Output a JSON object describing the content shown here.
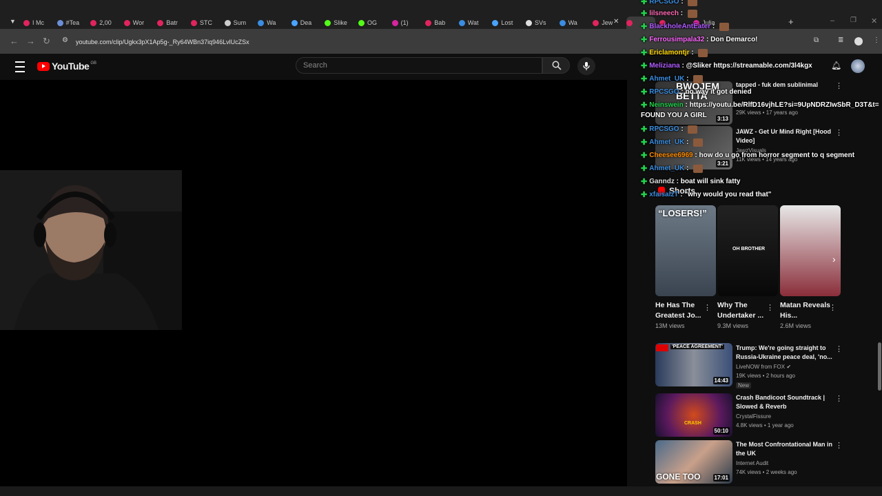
{
  "browser": {
    "tabs": [
      {
        "label": "I Mc",
        "color": "#e0245e"
      },
      {
        "label": "#Tea",
        "color": "#6b8fd6"
      },
      {
        "label": "2,00",
        "color": "#e0245e"
      },
      {
        "label": "Wor",
        "color": "#e0245e"
      },
      {
        "label": "Batr",
        "color": "#e0245e"
      },
      {
        "label": "STC",
        "color": "#e0245e"
      },
      {
        "label": "Sum",
        "color": "#cccccc"
      },
      {
        "label": "Wa",
        "color": "#3a8de0"
      },
      {
        "label": "Dea",
        "color": "#4aa3ff"
      },
      {
        "label": "Slike",
        "color": "#53fc18"
      },
      {
        "label": "OG",
        "color": "#53fc18"
      },
      {
        "label": "(1)",
        "color": "#d6249f"
      },
      {
        "label": "Bab",
        "color": "#e0245e"
      },
      {
        "label": "Wat",
        "color": "#3a8de0"
      },
      {
        "label": "Lost",
        "color": "#4aa3ff"
      },
      {
        "label": "SVs",
        "color": "#dddddd"
      },
      {
        "label": "Wa",
        "color": "#3a8de0"
      },
      {
        "label": "Jew",
        "color": "#e0245e"
      },
      {
        "label": "",
        "color": "#e0245e"
      },
      {
        "label": "",
        "color": "#e0245e"
      },
      {
        "label": "Julia",
        "color": "#d6249f"
      }
    ],
    "url": "youtube.com/clip/Ugkx3pX1Ap5g-_Ry64WBn37iq946LvlUcZSx"
  },
  "youtube": {
    "logo": "YouTube",
    "region": "GB",
    "search_placeholder": "Search"
  },
  "shorts": {
    "label": "Shorts",
    "items": [
      {
        "thumb_text": "“LOSERS!”",
        "title": "He Has The Greatest Jo...",
        "views": "13M views"
      },
      {
        "thumb_text": "OH BROTHER",
        "title": "Why The Undertaker ...",
        "views": "9.3M views"
      },
      {
        "thumb_text": "",
        "title": "Matan Reveals His...",
        "views": "2.6M views"
      }
    ]
  },
  "recommendations": {
    "top": [
      {
        "title": "tapped - fuk dem sublinimal",
        "meta": "29K views • 17 years ago",
        "duration": "3:13"
      },
      {
        "title": "JAWZ - Get Ur Mind Right [Hood Video]",
        "channel": "JawzVisuals",
        "meta": "11K views • 14 years ago",
        "duration": "3:21"
      }
    ],
    "list": [
      {
        "title": "Trump: We're going straight to Russia-Ukraine peace deal, 'no...",
        "channel": "LiveNOW from FOX",
        "meta": "19K views • 2 hours ago",
        "badge": "New",
        "duration": "14:43",
        "thumb_text": "'PEACE AGREEMENT'"
      },
      {
        "title": "Crash Bandicoot Soundtrack | Slowed & Reverb",
        "channel": "CrystalFissure",
        "meta": "4.8K views • 1 year ago",
        "duration": "50:10",
        "thumb_text": "CRASH"
      },
      {
        "title": "The Most Confrontational Man in the UK",
        "channel": "Internet Audit",
        "meta": "74K views • 2 weeks ago",
        "duration": "17:01",
        "thumb_text": "GONE TOO"
      }
    ]
  },
  "chat": [
    {
      "user": "RPCSGO",
      "color": "#3a8de0",
      "text": ""
    },
    {
      "user": "lilsneech",
      "color": "#ff69b4",
      "text": ""
    },
    {
      "user": "BlackholeAntEater",
      "color": "#b05cff",
      "text": ""
    },
    {
      "user": "Ferrousimpala32",
      "color": "#ff69ff",
      "text": "Don Demarco!"
    },
    {
      "user": "Ericlamontjr",
      "color": "#ffd700",
      "text": ""
    },
    {
      "user": "Meliziana",
      "color": "#b05cff",
      "text": "@Sliker https://streamable.com/3l4kgx"
    },
    {
      "user": "Ahmet_UK",
      "color": "#3a8de0",
      "text": ""
    },
    {
      "user": "RPCSGO",
      "color": "#3a8de0",
      "text": "no way it got denied"
    },
    {
      "user": "Neinswein",
      "color": "#22d34d",
      "text": "https://youtu.be/RlfD16vjhLE?si=9UpNDRZIwSbR_D3T&t="
    },
    {
      "user": "",
      "color": "#ffffff",
      "text": "FOUND YOU A GIRL"
    },
    {
      "user": "RPCSGO",
      "color": "#3a8de0",
      "text": ""
    },
    {
      "user": "Ahmet_UK",
      "color": "#3a8de0",
      "text": ""
    },
    {
      "user": "Cheesee6969",
      "color": "#ff8c00",
      "text": "how do u go from horror segment to q segment"
    },
    {
      "user": "Ahmet_UK",
      "color": "#3a8de0",
      "text": ""
    },
    {
      "user": "Ganndz",
      "color": "#dddddd",
      "text": "boat will sink fatty"
    },
    {
      "user": "xfaisalzT",
      "color": "#3a8de0",
      "text": "\"why would you read that\""
    }
  ],
  "overlay": {
    "line1": "BWOJEM",
    "line2": "BETTA"
  },
  "colors": {
    "accent": "#ff0000",
    "kick": "#53fc18"
  }
}
